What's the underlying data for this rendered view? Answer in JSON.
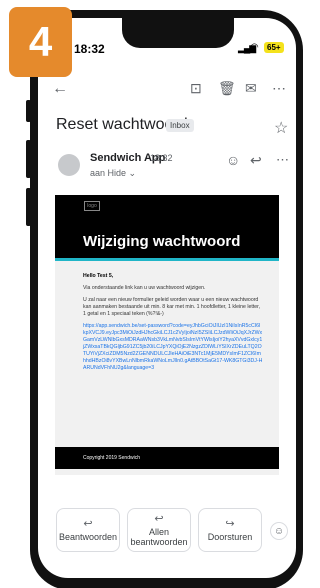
{
  "step_badge": "4",
  "status": {
    "time": "18:32",
    "battery": "65+"
  },
  "email": {
    "subject": "Reset wachtwoord",
    "label": "Inbox",
    "sender": "Sendwich App",
    "time": "18:32",
    "recipient": "aan Hide ⌄",
    "logo_text": "logo",
    "title": "Wijziging wachtwoord",
    "greeting": "Hello Test 5,",
    "line1": "Via onderstaande link kan u uw wachtwoord wijzigen.",
    "line2": "U zal naar een nieuw formulier geleid worden waar u een nieuw wachtwoord kan aanmaken bestaande uit min. 8 kar met min. 1 hoofdletter, 1 kleine letter, 1 getal en 1 speciaal teken (%?!&-)",
    "link": "https://app.sendwich.be/set-password?code=eyJhbGciOiJIUzI1NiIsInR5cCI6IkpXVCJ9.eyJpc3MiOiJzdHJhcGkiLCJ1c2VyIjoiNzI5ZSIiLCJzdWIiOiJqXJrZWxGamVzLWNlbGxsMDRAaWNsb3VkLmNvbSIsImVtYWlsIjoiY2hyaXVvdGxlcy1jZWxsaTBkQGljbG91ZC5jb20iLCJpYXQiOjE2NzgzZDIWLiYSIXrZDEuLTQ2OTUYiVjZXciZDM5Nzd2ZGENNDULCJleHAiOiE3NTc1MjE5MDYsImF1ZCI6ImhhdHBzOi8vYXBwLnNlbmRkaWNoLmJlIn0.gAtBBOtSaGt17-WK8GTGi3DJ-HARUNdVFhNU2g&language=3",
    "copyright": "Copyright 2019 Sendwich"
  },
  "actions": [
    {
      "label": "Beantwoorden",
      "icon": "reply-icon"
    },
    {
      "label": "Allen beantwoorden",
      "icon": "reply-all-icon"
    },
    {
      "label": "Doorsturen",
      "icon": "forward-icon"
    }
  ],
  "colors": {
    "badge": "#e58a2c",
    "accent_bar": "#20b5c7",
    "link": "#1a73e8",
    "battery": "#f4e21c"
  }
}
